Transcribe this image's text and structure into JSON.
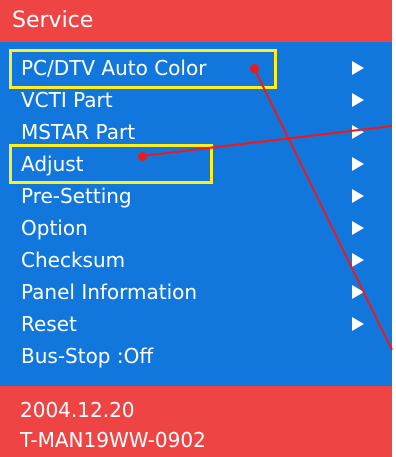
{
  "header": {
    "title": "Service"
  },
  "menu": {
    "items": [
      {
        "label": "PC/DTV Auto Color",
        "has_arrow": true,
        "highlighted": true
      },
      {
        "label": "VCTI Part",
        "has_arrow": true
      },
      {
        "label": "MSTAR Part",
        "has_arrow": true
      },
      {
        "label": "Adjust",
        "has_arrow": true,
        "highlighted": true
      },
      {
        "label": "Pre-Setting",
        "has_arrow": true
      },
      {
        "label": "Option",
        "has_arrow": true
      },
      {
        "label": "Checksum",
        "has_arrow": true
      },
      {
        "label": "Panel Information",
        "has_arrow": true
      },
      {
        "label": "Reset",
        "has_arrow": true
      },
      {
        "label": "Bus-Stop   :Off",
        "has_arrow": false
      }
    ]
  },
  "footer": {
    "date": "2004.12.20",
    "model": "T-MAN19WW-0902"
  },
  "colors": {
    "header_bg": "#ee4444",
    "menu_bg": "#1177dd",
    "highlight_box": "#ffee22",
    "annotation_line": "#ee1a1a",
    "text": "#ffffff"
  },
  "icons": {
    "submenu_arrow": "arrow-right-icon"
  }
}
